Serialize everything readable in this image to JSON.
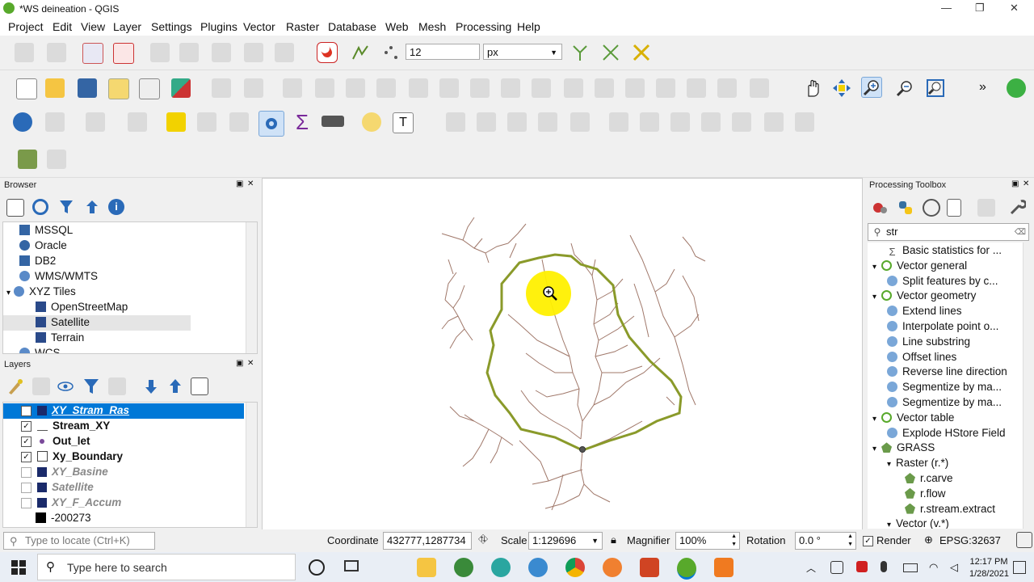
{
  "window": {
    "title": "*WS deineation - QGIS",
    "minimize": "—",
    "restore": "❐",
    "close": "✕"
  },
  "menu": [
    "Project",
    "Edit",
    "View",
    "Layer",
    "Settings",
    "Plugins",
    "Vector",
    "Raster",
    "Database",
    "Web",
    "Mesh",
    "Processing",
    "Help"
  ],
  "toolbar": {
    "snap_tolerance": "12",
    "snap_unit": "px",
    "more": "»"
  },
  "browser": {
    "title": "Browser",
    "items": [
      {
        "label": "MSSQL",
        "indent": 0
      },
      {
        "label": "Oracle",
        "indent": 0
      },
      {
        "label": "DB2",
        "indent": 0
      },
      {
        "label": "WMS/WMTS",
        "indent": 0
      },
      {
        "label": "XYZ Tiles",
        "indent": 0,
        "expanded": true
      },
      {
        "label": "OpenStreetMap",
        "indent": 1
      },
      {
        "label": "Satellite",
        "indent": 1,
        "selected": true
      },
      {
        "label": "Terrain",
        "indent": 1
      },
      {
        "label": "WCS",
        "indent": 0
      }
    ]
  },
  "layers": {
    "title": "Layers",
    "items": [
      {
        "label": "XY_Stram_Ras",
        "checked": false,
        "selected": true,
        "style": "italic-bold"
      },
      {
        "label": "Stream_XY",
        "checked": true,
        "style": "bold"
      },
      {
        "label": "Out_let",
        "checked": true,
        "style": "bold"
      },
      {
        "label": "Xy_Boundary",
        "checked": true,
        "style": "bold"
      },
      {
        "label": "XY_Basine",
        "checked": false,
        "style": "italic-bold-gray"
      },
      {
        "label": "Satellite",
        "checked": false,
        "style": "italic-bold-gray"
      },
      {
        "label": "XY_F_Accum",
        "checked": false,
        "style": "italic-bold-gray"
      },
      {
        "label": "-200273",
        "legend": true
      }
    ]
  },
  "toolbox": {
    "title": "Processing Toolbox",
    "search": "str",
    "items": [
      {
        "label": "Basic statistics for ...",
        "level": 2,
        "icon": "sigma"
      },
      {
        "label": "Vector general",
        "level": 1,
        "icon": "qgis"
      },
      {
        "label": "Split features by c...",
        "level": 2,
        "icon": "gear"
      },
      {
        "label": "Vector geometry",
        "level": 1,
        "icon": "qgis"
      },
      {
        "label": "Extend lines",
        "level": 2,
        "icon": "gear"
      },
      {
        "label": "Interpolate point o...",
        "level": 2,
        "icon": "gear"
      },
      {
        "label": "Line substring",
        "level": 2,
        "icon": "gear"
      },
      {
        "label": "Offset lines",
        "level": 2,
        "icon": "gear"
      },
      {
        "label": "Reverse line direction",
        "level": 2,
        "icon": "gear"
      },
      {
        "label": "Segmentize by ma...",
        "level": 2,
        "icon": "gear"
      },
      {
        "label": "Segmentize by ma...",
        "level": 2,
        "icon": "gear"
      },
      {
        "label": "Vector table",
        "level": 1,
        "icon": "qgis"
      },
      {
        "label": "Explode HStore Field",
        "level": 2,
        "icon": "gear"
      },
      {
        "label": "GRASS",
        "level": 1,
        "icon": "grass"
      },
      {
        "label": "Raster (r.*)",
        "level": 2,
        "icon": "none"
      },
      {
        "label": "r.carve",
        "level": 3,
        "icon": "grass"
      },
      {
        "label": "r.flow",
        "level": 3,
        "icon": "grass"
      },
      {
        "label": "r.stream.extract",
        "level": 3,
        "icon": "grass"
      },
      {
        "label": "Vector (v.*)",
        "level": 2,
        "icon": "none"
      }
    ]
  },
  "statusbar": {
    "locate_placeholder": "Type to locate (Ctrl+K)",
    "coordinate_label": "Coordinate",
    "coordinate_value": "432777,1287734",
    "scale_label": "Scale",
    "scale_value": "1:129696",
    "magnifier_label": "Magnifier",
    "magnifier_value": "100%",
    "rotation_label": "Rotation",
    "rotation_value": "0.0 °",
    "render_label": "Render",
    "crs": "EPSG:32637"
  },
  "taskbar": {
    "search_placeholder": "Type here to search",
    "time": "12:17 PM",
    "date": "1/28/2021"
  },
  "colors": {
    "boundary": "#8a9a2a",
    "streams": "#a0786a",
    "selection": "#0078d7",
    "highlight": "#fff000"
  }
}
